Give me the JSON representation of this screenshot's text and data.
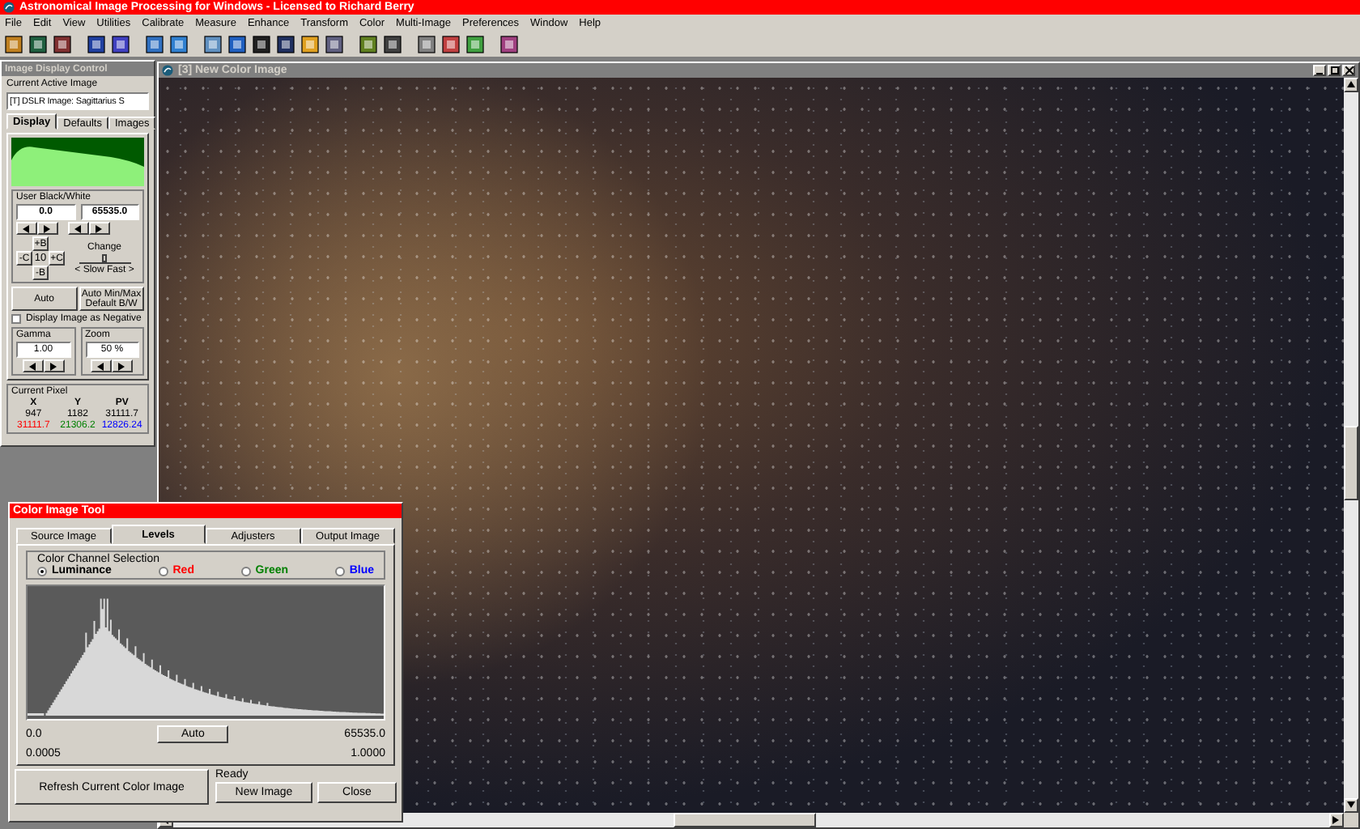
{
  "app_title": "Astronomical Image Processing for Windows - Licensed to Richard Berry",
  "menu": [
    "File",
    "Edit",
    "View",
    "Utilities",
    "Calibrate",
    "Measure",
    "Enhance",
    "Transform",
    "Color",
    "Multi-Image",
    "Preferences",
    "Window",
    "Help"
  ],
  "display_control": {
    "title": "Image Display Control",
    "active_image_label": "Current Active Image",
    "active_image_value": "[T] DSLR Image: Sagittarius S",
    "tabs": [
      {
        "label": "Display",
        "selected": true
      },
      {
        "label": "Defaults",
        "selected": false
      },
      {
        "label": "Images",
        "selected": false
      }
    ],
    "user_bw_label": "User Black/White",
    "black_value": "0.0",
    "white_value": "65535.0",
    "step_buttons": {
      "top": "+B",
      "left": "-C",
      "value": "10",
      "right": "+C",
      "bottom": "-B"
    },
    "change_label": "Change",
    "speed_slider": {
      "level": 0.5
    },
    "speed_label": "< Slow Fast >",
    "auto_button": "Auto",
    "minmax_button": [
      "Auto Min/Max",
      "Default B/W"
    ],
    "negative": {
      "label": "Display Image as Negative",
      "checked": false
    },
    "gamma": {
      "label": "Gamma",
      "value": "1.00"
    },
    "zoom": {
      "label": "Zoom",
      "value": "50 %"
    },
    "pixel": {
      "label": "Current Pixel",
      "headers": [
        "X",
        "Y",
        "PV"
      ],
      "values": [
        "947",
        "1182",
        "31111.7"
      ],
      "rgb": [
        {
          "value": "31111.7",
          "color": "#ff0000"
        },
        {
          "value": "21306.2",
          "color": "#008000"
        },
        {
          "value": "12826.24",
          "color": "#0000ff"
        }
      ]
    }
  },
  "image_window": {
    "title": "[3] New Color Image"
  },
  "color_tool": {
    "title": "Color Image Tool",
    "tabs": [
      {
        "label": "Source Image",
        "selected": false
      },
      {
        "label": "Levels",
        "selected": true
      },
      {
        "label": "Adjusters",
        "selected": false
      },
      {
        "label": "Output Image",
        "selected": false
      }
    ],
    "channel_group_label": "Color Channel Selection",
    "channels": [
      {
        "label": "Luminance",
        "selected": true,
        "color": "#000000"
      },
      {
        "label": "Red",
        "selected": false,
        "color": "#ff0000"
      },
      {
        "label": "Green",
        "selected": false,
        "color": "#008000"
      },
      {
        "label": "Blue",
        "selected": false,
        "color": "#0000ff"
      }
    ],
    "min_value": "0.0",
    "auto_button": "Auto",
    "max_value": "65535.0",
    "low_value": "0.0005",
    "high_value": "1.0000",
    "refresh_button": "Refresh Current Color Image",
    "status": "Ready",
    "new_button": "New Image",
    "close_button": "Close"
  }
}
